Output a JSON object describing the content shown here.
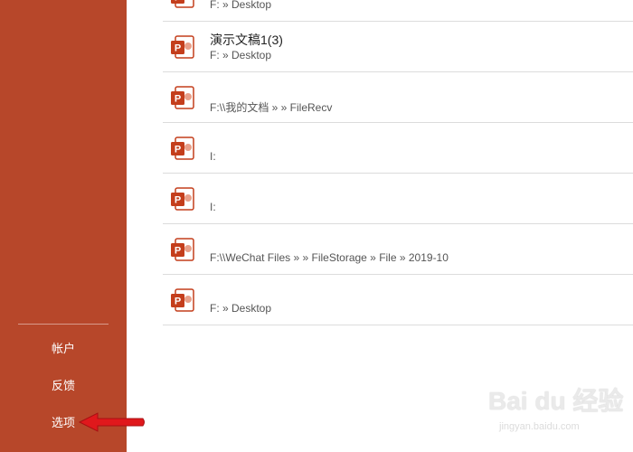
{
  "sidebar": {
    "bg_color": "#b7472a",
    "items": [
      {
        "label": "帐户"
      },
      {
        "label": "反馈"
      },
      {
        "label": "选项"
      }
    ]
  },
  "annotation": {
    "icon": "red-arrow-icon",
    "color": "#e0181c"
  },
  "recent_files": [
    {
      "name": "",
      "path": "F: » Desktop",
      "icon": "powerpoint-file-icon"
    },
    {
      "name": "演示文稿1(3)",
      "path": "F: » Desktop",
      "icon": "powerpoint-file-icon"
    },
    {
      "name": "",
      "path": "F:\\\\我的文档 »                 » FileRecv",
      "icon": "powerpoint-file-icon"
    },
    {
      "name": "",
      "path": "I:",
      "icon": "powerpoint-file-icon"
    },
    {
      "name": "",
      "path": "I:",
      "icon": "powerpoint-file-icon"
    },
    {
      "name": "",
      "path": "F:\\\\WeChat Files »           » FileStorage » File » 2019-10",
      "icon": "powerpoint-file-icon"
    },
    {
      "name": "",
      "path": "F: » Desktop",
      "icon": "powerpoint-file-icon"
    }
  ],
  "watermark": {
    "brand": "Bai du 经验",
    "sub": "jingyan.baidu.com"
  },
  "colors": {
    "ppt_red": "#c43e1c",
    "divider": "#dcdcdc"
  }
}
